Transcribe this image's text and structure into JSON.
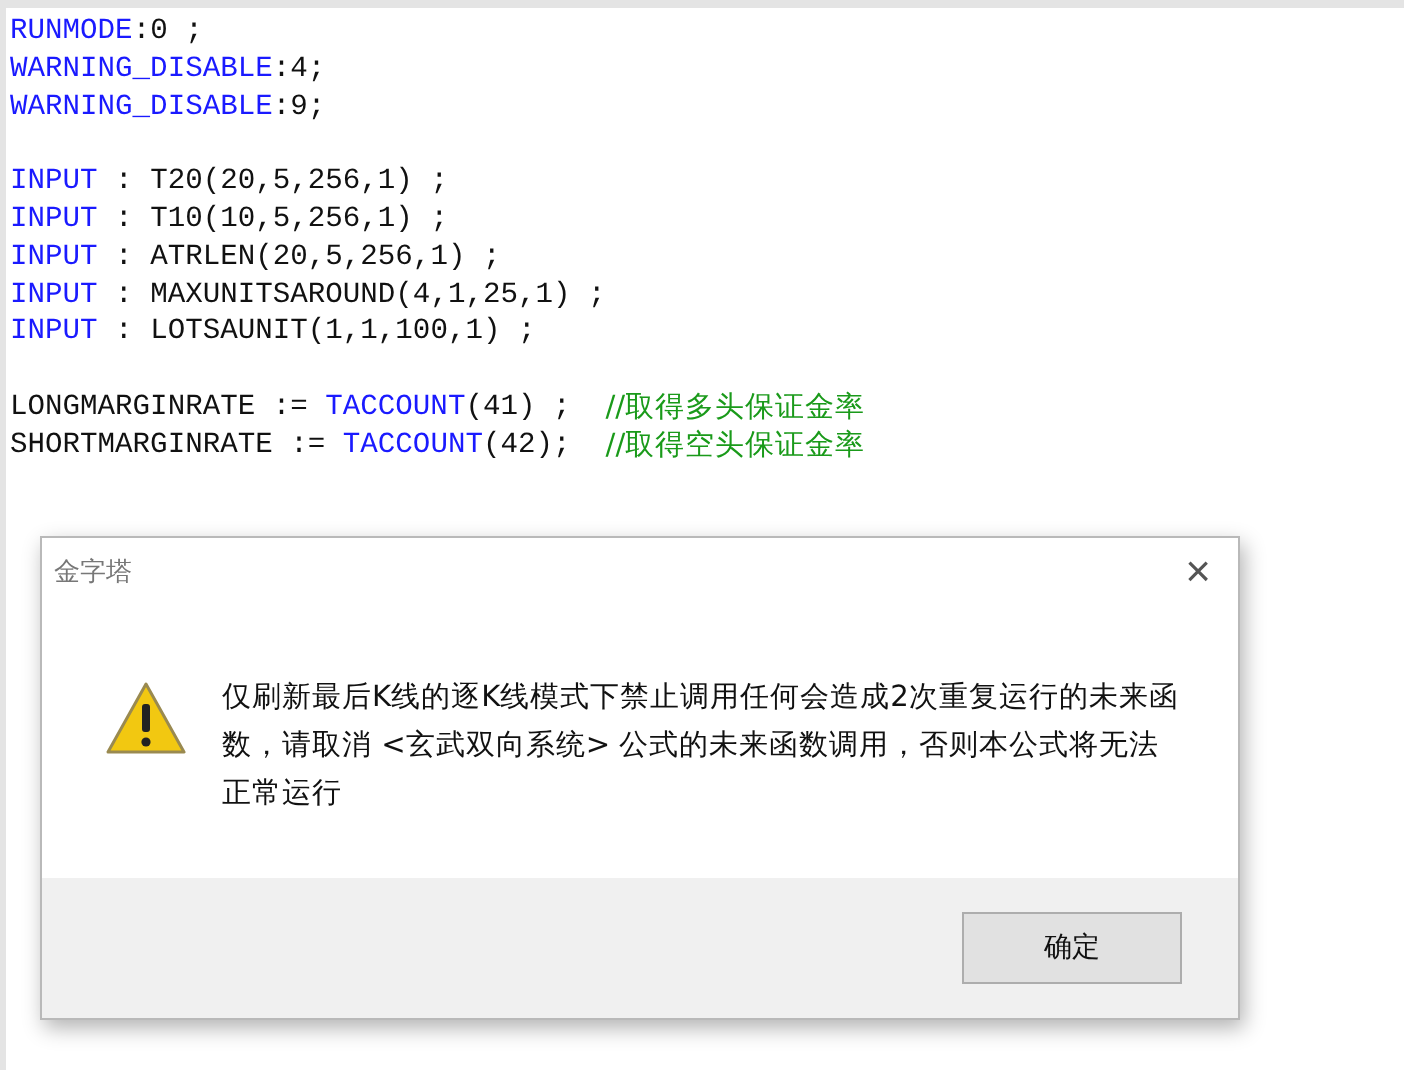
{
  "editor": {
    "lines": [
      {
        "kind": "code",
        "tokens": [
          {
            "kind": "keyword",
            "text": "RUNMODE"
          },
          {
            "kind": "plain",
            "text": ":0 ;"
          }
        ]
      },
      {
        "kind": "code",
        "tokens": [
          {
            "kind": "keyword",
            "text": "WARNING_DISABLE"
          },
          {
            "kind": "plain",
            "text": ":4;"
          }
        ]
      },
      {
        "kind": "code",
        "tokens": [
          {
            "kind": "keyword",
            "text": "WARNING_DISABLE"
          },
          {
            "kind": "plain",
            "text": ":9;"
          }
        ]
      },
      {
        "kind": "blank"
      },
      {
        "kind": "code",
        "tokens": [
          {
            "kind": "keyword",
            "text": "INPUT"
          },
          {
            "kind": "plain",
            "text": " : T20(20,5,256,1) ;"
          }
        ]
      },
      {
        "kind": "code",
        "tokens": [
          {
            "kind": "keyword",
            "text": "INPUT"
          },
          {
            "kind": "plain",
            "text": " : T10(10,5,256,1) ;"
          }
        ]
      },
      {
        "kind": "code",
        "tokens": [
          {
            "kind": "keyword",
            "text": "INPUT"
          },
          {
            "kind": "plain",
            "text": " : ATRLEN(20,5,256,1) ;"
          }
        ]
      },
      {
        "kind": "code",
        "tokens": [
          {
            "kind": "keyword",
            "text": "INPUT"
          },
          {
            "kind": "plain",
            "text": " : MAXUNITSAROUND(4,1,25,1) ;"
          }
        ]
      },
      {
        "kind": "code",
        "tokens": [
          {
            "kind": "keyword",
            "text": "INPUT"
          },
          {
            "kind": "plain",
            "text": " : LOTSAUNIT(1,1,100,1) ;"
          }
        ]
      },
      {
        "kind": "blank"
      },
      {
        "kind": "code",
        "tokens": [
          {
            "kind": "plain",
            "text": "LONGMARGINRATE := "
          },
          {
            "kind": "keyword",
            "text": "TACCOUNT"
          },
          {
            "kind": "plain",
            "text": "(41) ;  "
          },
          {
            "kind": "comment",
            "text": "//取得多头保证金率"
          }
        ]
      },
      {
        "kind": "code",
        "tokens": [
          {
            "kind": "plain",
            "text": "SHORTMARGINRATE := "
          },
          {
            "kind": "keyword",
            "text": "TACCOUNT"
          },
          {
            "kind": "plain",
            "text": "(42);  "
          },
          {
            "kind": "comment",
            "text": "//取得空头保证金率"
          }
        ]
      }
    ]
  },
  "dialog": {
    "title": "金字塔",
    "close": "×",
    "message": "仅刷新最后K线的逐K线模式下禁止调用任何会造成2次重复运行的未来函数，请取消 <玄武双向系统> 公式的未来函数调用，否则本公式将无法正常运行",
    "buttons": [
      "确定"
    ]
  }
}
